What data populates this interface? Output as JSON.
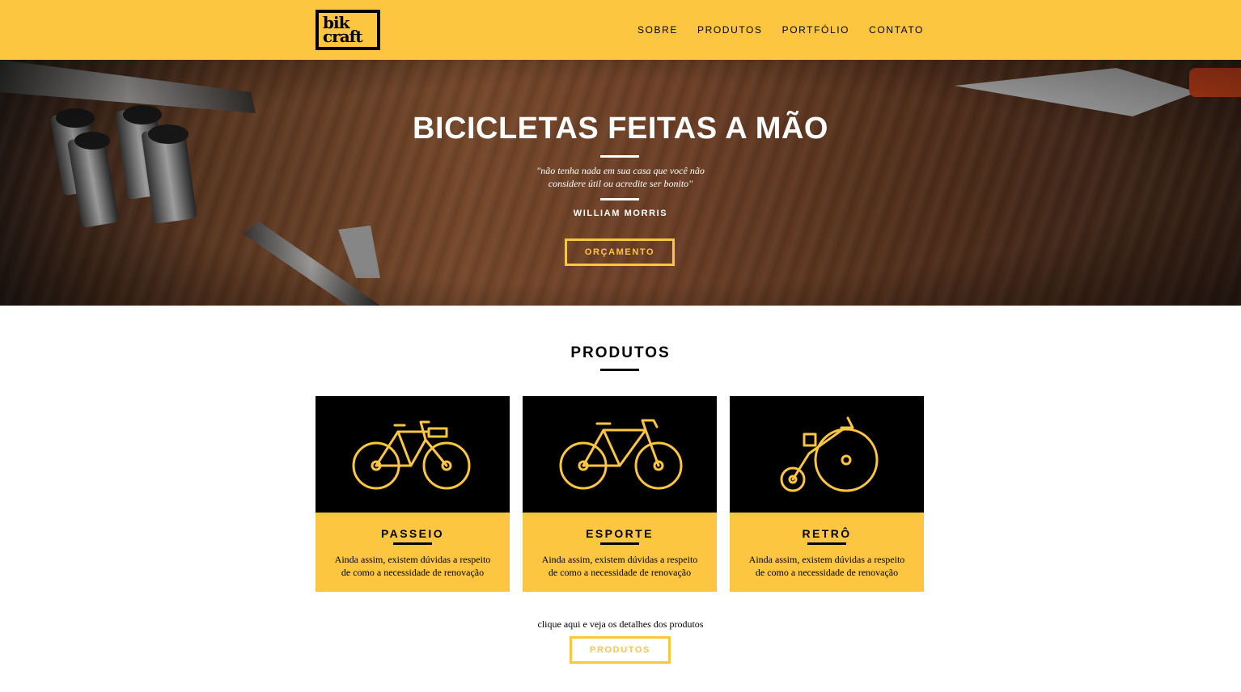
{
  "header": {
    "logo": {
      "line1": "bik",
      "line2": "craft"
    },
    "nav": [
      "SOBRE",
      "PRODUTOS",
      "PORTFÓLIO",
      "CONTATO"
    ]
  },
  "hero": {
    "title": "BICICLETAS FEITAS A MÃO",
    "quote_line1": "\"não tenha nada em sua casa que você não",
    "quote_line2": "considere útil ou acredite ser bonito\"",
    "author": "WILLIAM MORRIS",
    "cta": "ORÇAMENTO"
  },
  "products": {
    "title": "PRODUTOS",
    "items": [
      {
        "name": "PASSEIO",
        "icon": "city-bike-icon",
        "desc_line1": "Ainda assim, existem dúvidas a respeito",
        "desc_line2": "de como a necessidade de renovação"
      },
      {
        "name": "ESPORTE",
        "icon": "road-bike-icon",
        "desc_line1": "Ainda assim, existem dúvidas a respeito",
        "desc_line2": "de como a necessidade de renovação"
      },
      {
        "name": "RETRÔ",
        "icon": "penny-farthing-icon",
        "desc_line1": "Ainda assim, existem dúvidas a respeito",
        "desc_line2": "de como a necessidade de renovação"
      }
    ],
    "more_text": "clique aqui e veja os detalhes dos produtos",
    "more_button": "PRODUTOS"
  },
  "colors": {
    "accent": "#FDC640",
    "dark": "#000000",
    "text_light": "#FFFFFF"
  }
}
